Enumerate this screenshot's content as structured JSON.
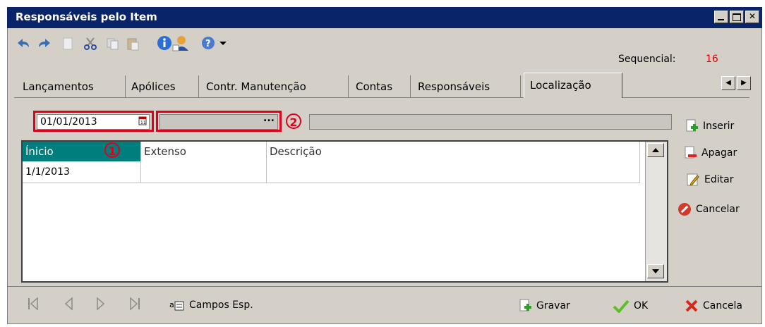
{
  "window": {
    "title": "Responsáveis pelo Item"
  },
  "toolbar": {
    "icons": [
      "undo-icon",
      "redo-icon",
      "new-document-icon",
      "cut-icon",
      "copy-icon",
      "paste-icon",
      "info-icon",
      "user-icon",
      "help-icon",
      "dropdown-arrow-icon"
    ],
    "sequencial_label": "Sequencial:",
    "sequencial_value": "16"
  },
  "tabs": [
    "Lançamentos",
    "Apólices",
    "Contr. Manutenção",
    "Contas",
    "Responsáveis",
    "Localização"
  ],
  "form": {
    "date_value": "01/01/2013",
    "lookup_button": "...",
    "marker1": "1",
    "marker2": "2"
  },
  "grid": {
    "columns": [
      "Ínicio",
      "Extenso",
      "Descrição"
    ],
    "rows": [
      [
        "1/1/2013",
        "",
        ""
      ]
    ]
  },
  "side_buttons": {
    "inserir": "Inserir",
    "apagar": "Apagar",
    "editar": "Editar",
    "cancelar": "Cancelar"
  },
  "bottom": {
    "campos": "Campos Esp.",
    "gravar": "Gravar",
    "ok": "OK",
    "cancela": "Cancela"
  },
  "colors": {
    "title_bar": "#0a246a",
    "grid_header_selected": "#007d7d",
    "highlight": "#e0001b",
    "sequencial_value": "#e00000"
  }
}
